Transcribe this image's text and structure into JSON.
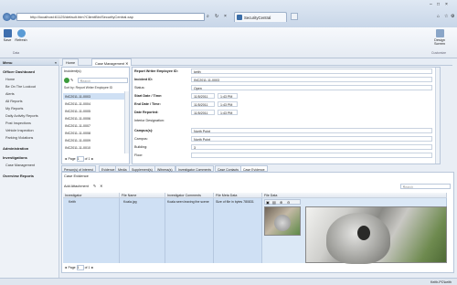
{
  "browser": {
    "address": "http://localhost:61125/default.htm?ClientBin/SecurityCentral.xap",
    "tab_title": "SecurityCentral"
  },
  "ribbon": {
    "save_label": "Save",
    "refresh_label": "Refresh",
    "group_data": "Data",
    "design_label": "Design Screen",
    "group_customize": "Customize"
  },
  "menu": {
    "header": "Menu",
    "officer_dashboard": "Officer Dashboard",
    "officer_items": [
      "Home",
      "Be On The Lookout",
      "Alerts",
      "All Reports",
      "My Reports",
      "Daily Activity Reports",
      "Post Inspections",
      "Vehicle Inspection",
      "Parking Violations"
    ],
    "administration": "Administration",
    "investigations": "Investigations",
    "case_management": "Case Management",
    "overview_reports": "Overview Reports"
  },
  "doc_tabs": [
    "Home",
    "Case Management"
  ],
  "incidents": {
    "title": "Incident(s)",
    "search_placeholder": "Search",
    "sort_label": "Sort by: Report Writer Employee ID",
    "rows": [
      "INC2011-11-0003",
      "INC2011-11-0004",
      "INC2011-11-0005",
      "INC2011-11-0006",
      "INC2011-11-0007",
      "INC2011-11-0008",
      "INC2011-11-0009",
      "INC2011-11-0010"
    ],
    "page_label": "Page",
    "page_value": "1",
    "of_label": "of 1"
  },
  "form": {
    "fields": [
      {
        "label": "Report Writer Employee ID:",
        "value": "keith",
        "bold": true
      },
      {
        "label": "Incident ID:",
        "value": "INC2011-11-0003",
        "bold": true
      },
      {
        "label": "Status:",
        "value": "Open",
        "bold": false
      },
      {
        "label": "Start Date / Time:",
        "value": "11/5/2011",
        "time": "1:43 PM",
        "bold": true
      },
      {
        "label": "End Date / Time:",
        "value": "11/5/2011",
        "time": "1:43 PM",
        "bold": true
      },
      {
        "label": "Date Reported:",
        "value": "11/5/2011",
        "time": "1:43 PM",
        "bold": true
      },
      {
        "label": "Interior Designation:",
        "value": "",
        "bold": false
      },
      {
        "label": "Campus(s):",
        "value": "North Point",
        "bold": true
      },
      {
        "label": "Campus:",
        "value": "North Point",
        "bold": false
      },
      {
        "label": "Building:",
        "value": "3",
        "bold": false
      },
      {
        "label": "Floor:",
        "value": "",
        "bold": false
      }
    ]
  },
  "sub_tabs": [
    "Person(s) of Interest",
    "Evidence",
    "Media",
    "Supplement(s)",
    "Witness(s)",
    "Investigator Comments",
    "Case Contacts",
    "Case Evidence"
  ],
  "evidence": {
    "title": "Case Evidence",
    "add_label": "Add Attachment",
    "search_placeholder": "Search",
    "columns": [
      "Investigator",
      "File Name",
      "Investigator Comments",
      "File Meta Data",
      "File Data"
    ],
    "row": {
      "investigator": "Keith",
      "file_name": "Koala.jpg",
      "comments": "Koala seen leaving the scene",
      "meta": "Size of file in bytes 780831"
    },
    "page_label": "Page",
    "page_value": "1",
    "of_label": "of 1"
  },
  "status": {
    "user": "Keith-PC\\keith"
  },
  "colors": {
    "selected_row": "#cfe0f4",
    "accent": "#2e5f9e"
  }
}
